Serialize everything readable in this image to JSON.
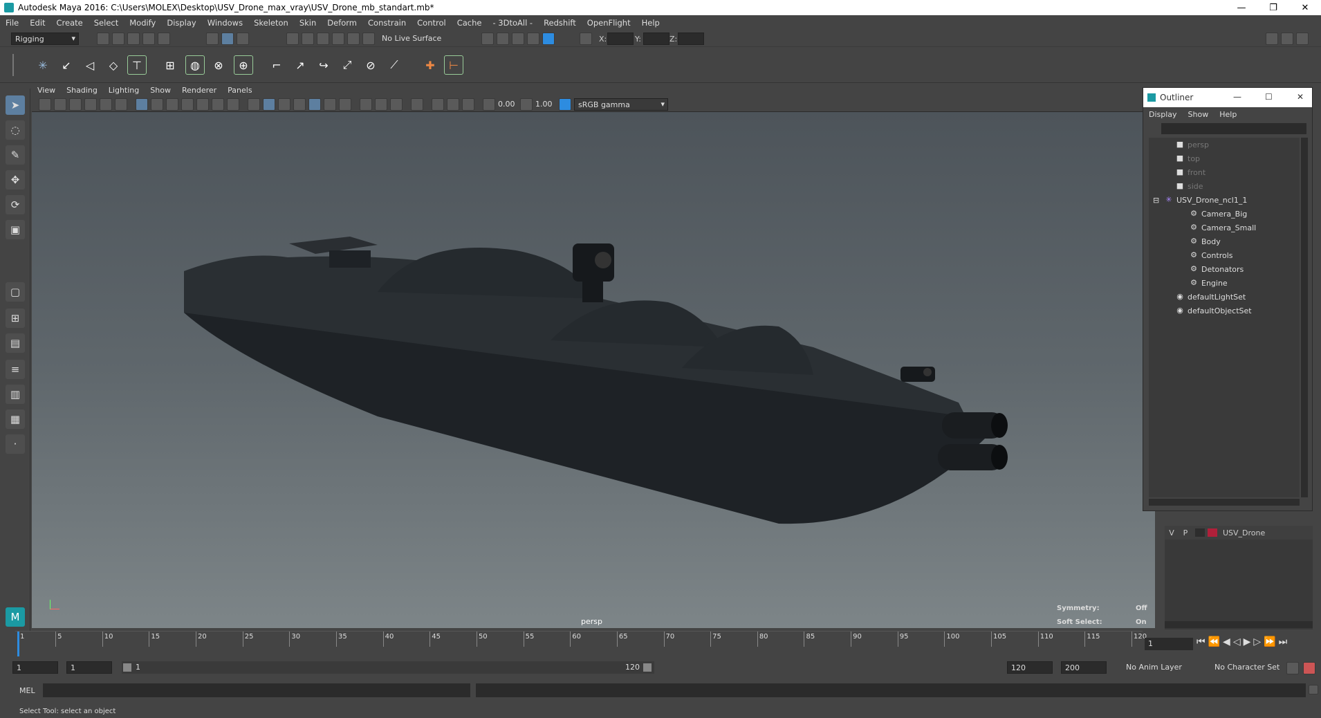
{
  "window": {
    "title": "Autodesk Maya 2016: C:\\Users\\MOLEX\\Desktop\\USV_Drone_max_vray\\USV_Drone_mb_standart.mb*"
  },
  "menubar": [
    "File",
    "Edit",
    "Create",
    "Select",
    "Modify",
    "Display",
    "Windows",
    "Skeleton",
    "Skin",
    "Deform",
    "Constrain",
    "Control",
    "Cache",
    "- 3DtoAll -",
    "Redshift",
    "OpenFlight",
    "Help"
  ],
  "statusline": {
    "menu_set": "Rigging",
    "live_surface": "No Live Surface",
    "x_label": "X:",
    "y_label": "Y:",
    "z_label": "Z:"
  },
  "panel_menu": [
    "View",
    "Shading",
    "Lighting",
    "Show",
    "Renderer",
    "Panels"
  ],
  "panel_toolbar": {
    "exposure": "0.00",
    "gamma": "1.00",
    "color_space": "sRGB gamma"
  },
  "viewport": {
    "camera_name": "persp",
    "symmetry_label": "Symmetry:",
    "symmetry_value": "Off",
    "soft_select_label": "Soft Select:",
    "soft_select_value": "On"
  },
  "outliner": {
    "title": "Outliner",
    "menu": [
      "Display",
      "Show",
      "Help"
    ],
    "items": [
      {
        "label": "persp",
        "depth": 1,
        "type": "camera",
        "dim": true
      },
      {
        "label": "top",
        "depth": 1,
        "type": "camera",
        "dim": true
      },
      {
        "label": "front",
        "depth": 1,
        "type": "camera",
        "dim": true
      },
      {
        "label": "side",
        "depth": 1,
        "type": "camera",
        "dim": true
      },
      {
        "label": "USV_Drone_ncl1_1",
        "depth": 0,
        "type": "group",
        "dim": false
      },
      {
        "label": "Camera_Big",
        "depth": 2,
        "type": "transform",
        "dim": false
      },
      {
        "label": "Camera_Small",
        "depth": 2,
        "type": "transform",
        "dim": false
      },
      {
        "label": "Body",
        "depth": 2,
        "type": "transform",
        "dim": false
      },
      {
        "label": "Controls",
        "depth": 2,
        "type": "transform",
        "dim": false
      },
      {
        "label": "Detonators",
        "depth": 2,
        "type": "transform",
        "dim": false
      },
      {
        "label": "Engine",
        "depth": 2,
        "type": "transform",
        "dim": false
      },
      {
        "label": "defaultLightSet",
        "depth": 1,
        "type": "set",
        "dim": false
      },
      {
        "label": "defaultObjectSet",
        "depth": 1,
        "type": "set",
        "dim": false
      }
    ]
  },
  "layers": [
    {
      "visible": "V",
      "playback": "P",
      "name": "USV_Drone",
      "color": "#b0203a"
    }
  ],
  "timeline": {
    "ticks": [
      "1",
      "5",
      "10",
      "15",
      "20",
      "25",
      "30",
      "35",
      "40",
      "45",
      "50",
      "55",
      "60",
      "65",
      "70",
      "75",
      "80",
      "85",
      "90",
      "95",
      "100",
      "105",
      "110",
      "115",
      "120"
    ],
    "current_frame": "1"
  },
  "range": {
    "start": "1",
    "anim_start": "1",
    "range_start": "1",
    "range_end": "120",
    "playback_end": "120",
    "anim_end": "200",
    "anim_layer": "No Anim Layer",
    "character_set": "No Character Set"
  },
  "command_line": {
    "label": "MEL"
  },
  "help_line": {
    "text": "Select Tool: select an object"
  },
  "colors": {
    "bg": "#444444",
    "viewport_top": "#4d545a",
    "viewport_bottom": "#7d8588",
    "accent_blue": "#2d8ce0",
    "layer_red": "#b0203a"
  }
}
